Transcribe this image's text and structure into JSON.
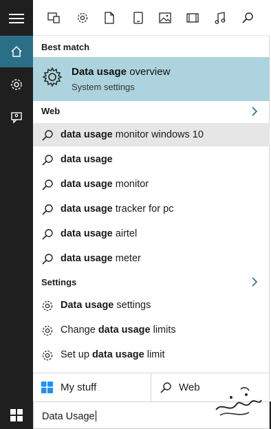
{
  "rail": {
    "items": [
      {
        "name": "hamburger-menu"
      },
      {
        "name": "home"
      },
      {
        "name": "settings"
      },
      {
        "name": "feedback"
      }
    ]
  },
  "toolbar": {
    "categories": [
      "apps",
      "settings",
      "documents",
      "tablet",
      "photos",
      "videos",
      "music",
      "web-search"
    ]
  },
  "best_match": {
    "heading": "Best match",
    "title_bold": "Data usage",
    "title_rest": " overview",
    "subtitle": "System settings"
  },
  "web": {
    "heading": "Web",
    "results": [
      {
        "bold": "data usage",
        "rest": " monitor windows 10"
      },
      {
        "bold": "data usage",
        "rest": ""
      },
      {
        "bold": "data usage",
        "rest": " monitor"
      },
      {
        "bold": "data usage",
        "rest": " tracker for pc"
      },
      {
        "bold": "data usage",
        "rest": " airtel"
      },
      {
        "bold": "data usage",
        "rest": " meter"
      }
    ]
  },
  "settings": {
    "heading": "Settings",
    "results": [
      {
        "pre": "",
        "bold": "Data usage",
        "rest": " settings"
      },
      {
        "pre": "Change ",
        "bold": "data usage",
        "rest": " limits"
      },
      {
        "pre": "Set up ",
        "bold": "data usage",
        "rest": " limit"
      }
    ]
  },
  "tabs": {
    "my_stuff": "My stuff",
    "web": "Web"
  },
  "search": {
    "query": "Data Usage"
  },
  "colors": {
    "rail_bg": "#1f1f1f",
    "accent_home": "#2b6f86",
    "best_match_bg": "#add4de",
    "hover_row": "#e6e6e6",
    "chevron": "#2b6f86",
    "windows_logo": "#1e90ff"
  }
}
